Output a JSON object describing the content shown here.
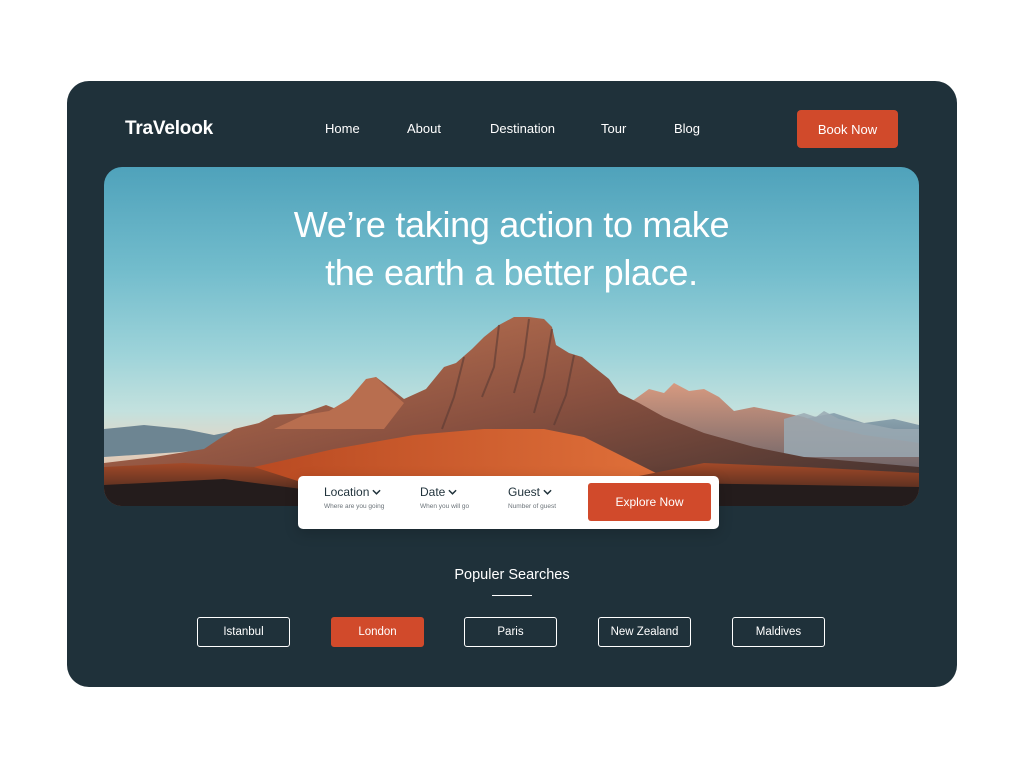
{
  "brand": {
    "logo_text": "TraVelook"
  },
  "nav": {
    "items": [
      {
        "label": "Home"
      },
      {
        "label": "About"
      },
      {
        "label": "Destination"
      },
      {
        "label": "Tour"
      },
      {
        "label": "Blog"
      }
    ],
    "cta_label": "Book Now"
  },
  "hero": {
    "title_line1": "We’re taking action to make",
    "title_line2": "the earth a better place."
  },
  "search": {
    "fields": [
      {
        "label": "Location",
        "hint": "Where are you going",
        "icon": "chevron-down-icon"
      },
      {
        "label": "Date",
        "hint": "When you will go",
        "icon": "chevron-down-icon"
      },
      {
        "label": "Guest",
        "hint": "Number of guest",
        "icon": "chevron-down-icon"
      }
    ],
    "button_label": "Explore Now"
  },
  "popular": {
    "title": "Populer Searches",
    "chips": [
      {
        "label": "Istanbul",
        "active": false
      },
      {
        "label": "London",
        "active": true
      },
      {
        "label": "Paris",
        "active": false
      },
      {
        "label": "New Zealand",
        "active": false
      },
      {
        "label": "Maldives",
        "active": false
      }
    ]
  },
  "colors": {
    "background_panel": "#1f313a",
    "accent": "#d14a2b",
    "page_background": "#ffffff"
  }
}
